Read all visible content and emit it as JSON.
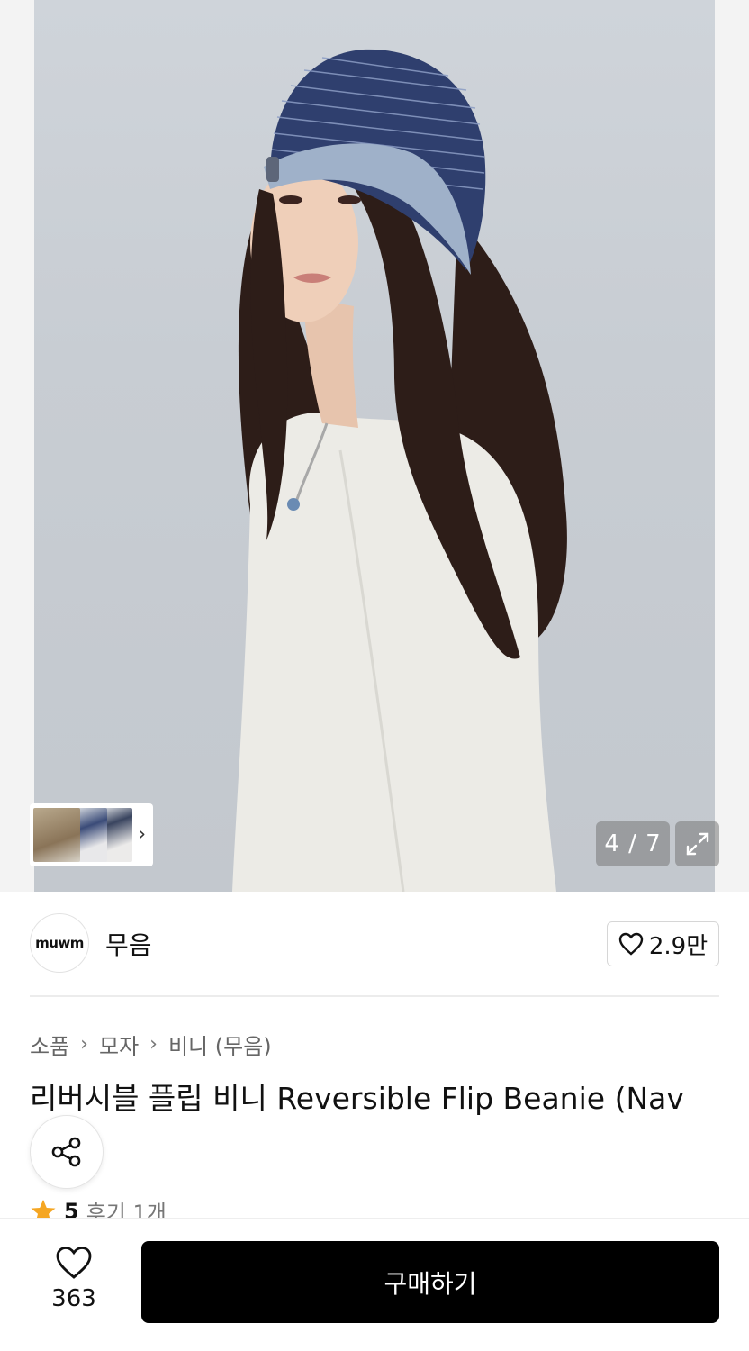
{
  "gallery": {
    "counter": "4 / 7",
    "expand_icon": "expand-icon",
    "thumb_arrow": "›",
    "colors": {
      "background": "#c8cdd3",
      "hat": "#2f3f6e",
      "hat_brim": "#9fb1c9",
      "shirt": "#ecebe6",
      "hair": "#2d1d18"
    }
  },
  "brand": {
    "logo_text": "muwm",
    "name": "무음",
    "likes": "2.9만"
  },
  "breadcrumb": [
    "소품",
    "모자",
    "비니 (무음)"
  ],
  "product": {
    "title": "리버시블 플립 비니 Reversible Flip Beanie (Nav",
    "rating": "5",
    "review_label": "후기 1개"
  },
  "bottom_bar": {
    "wish_count": "363",
    "buy_label": "구매하기",
    "button_color": "#000000"
  }
}
